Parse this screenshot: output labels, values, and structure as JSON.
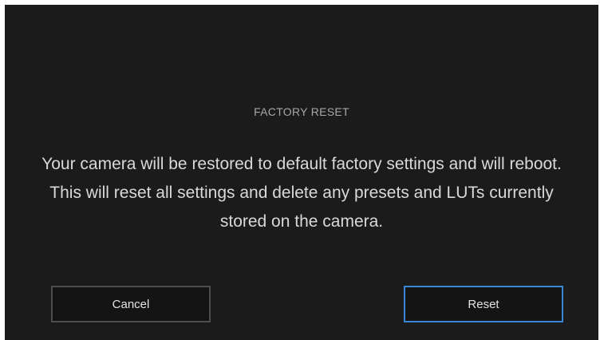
{
  "dialog": {
    "title": "FACTORY RESET",
    "message": "Your camera will be restored to default factory settings and will reboot. This will reset all settings and delete any presets and LUTs currently stored on the camera."
  },
  "buttons": {
    "cancel_label": "Cancel",
    "reset_label": "Reset"
  },
  "colors": {
    "background": "#1b1b1b",
    "accent": "#3a86d6",
    "button_border": "#4d4d4d"
  }
}
